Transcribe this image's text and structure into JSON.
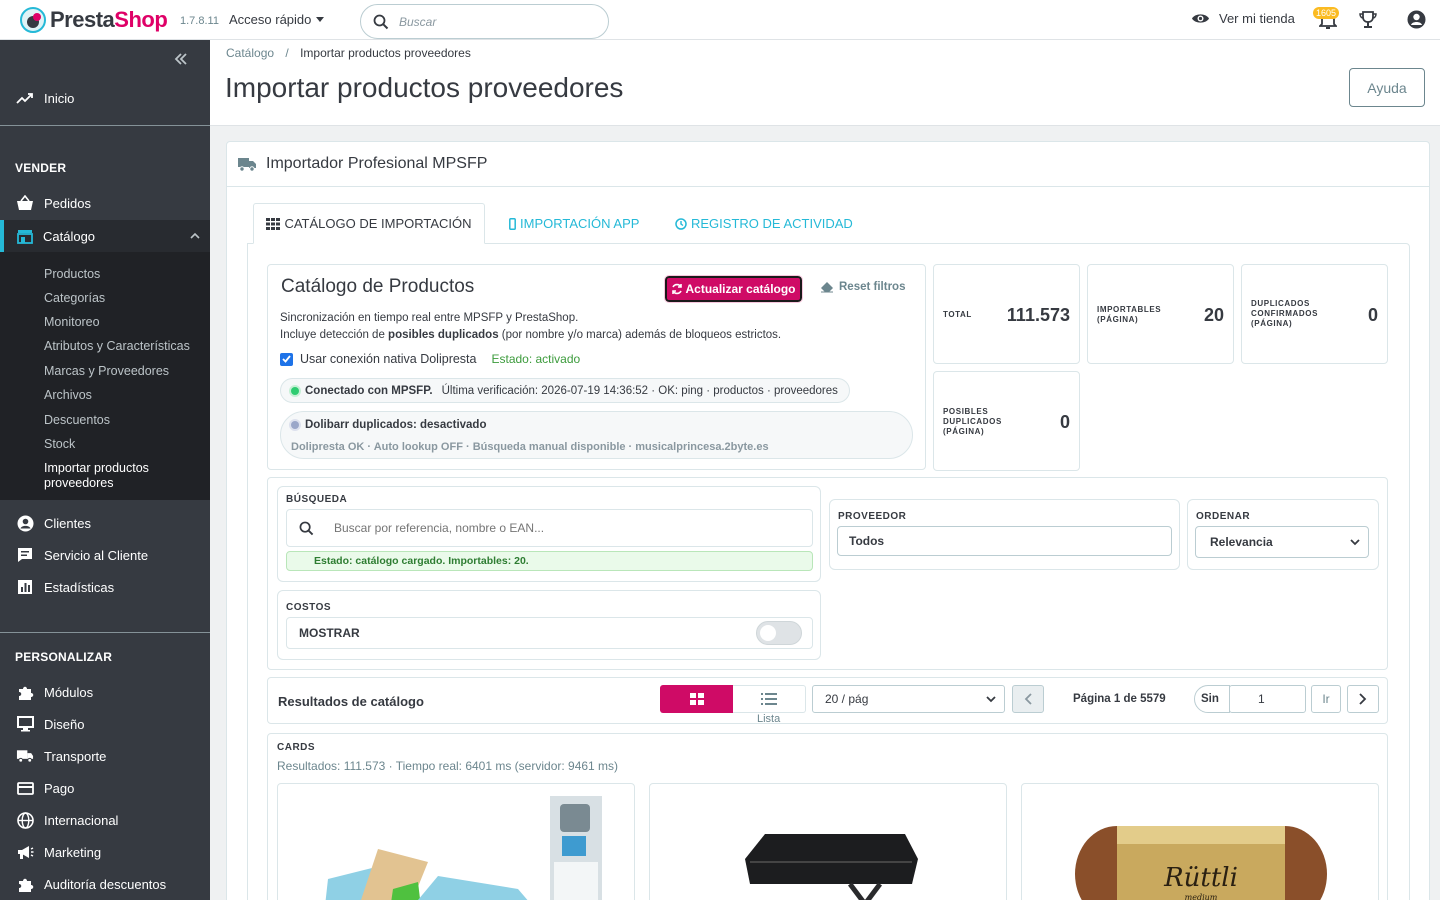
{
  "header": {
    "brand_a": "Presta",
    "brand_b": "Shop",
    "version": "1.7.8.11",
    "quick_access": "Acceso rápido",
    "search_placeholder": "Buscar",
    "view_shop": "Ver mi tienda",
    "notifications_count": "1605"
  },
  "sidebar": {
    "home": "Inicio",
    "sell_section": "VENDER",
    "orders": "Pedidos",
    "catalog": "Catálogo",
    "catalog_items": [
      "Productos",
      "Categorías",
      "Monitoreo",
      "Atributos y Características",
      "Marcas y Proveedores",
      "Archivos",
      "Descuentos",
      "Stock",
      "Importar productos proveedores"
    ],
    "customers": "Clientes",
    "service": "Servicio al Cliente",
    "stats": "Estadísticas",
    "custom_section": "PERSONALIZAR",
    "modules": "Módulos",
    "design": "Diseño",
    "shipping": "Transporte",
    "payment": "Pago",
    "international": "Internacional",
    "marketing": "Marketing",
    "audit": "Auditoría descuentos"
  },
  "page": {
    "breadcrumb_parent": "Catálogo",
    "breadcrumb_sep": "/",
    "breadcrumb_current": "Importar productos proveedores",
    "title": "Importar productos proveedores",
    "help": "Ayuda"
  },
  "panel": {
    "title": "Importador Profesional MPSFP",
    "tabs": [
      "CATÁLOGO DE IMPORTACIÓN",
      "IMPORTACIÓN APP",
      "REGISTRO DE ACTIVIDAD"
    ]
  },
  "catalog": {
    "title": "Catálogo de Productos",
    "update_button": "Actualizar catálogo",
    "reset_button": "Reset filtros",
    "desc_line1": "Sincronización en tiempo real entre MPSFP y PrestaShop.",
    "desc_line2_a": "Incluye detección de ",
    "desc_line2_b": "posibles duplicados",
    "desc_line2_c": " (por nombre y/o marca) además de bloqueos estrictos.",
    "native_label": "Usar conexión nativa Dolipresta",
    "native_status": "Estado: activado",
    "conn_label": "Conectado con MPSFP.",
    "conn_detail": "Última verificación: 2026-07-19 14:36:52 · OK: ping · productos · proveedores",
    "doli_label": "Dolibarr duplicados: desactivado",
    "doli_detail": "Dolipresta OK · Auto lookup OFF · Búsqueda manual disponible · musicalprincesa.2byte.es"
  },
  "stats": {
    "total_label": "TOTAL",
    "total_value": "111.573",
    "importables_label_1": "IMPORTABLES",
    "importables_label_2": "(PÁGINA)",
    "importables_value": "20",
    "dup_label_1": "DUPLICADOS",
    "dup_label_2": "CONFIRMADOS",
    "dup_label_3": "(PÁGINA)",
    "dup_value": "0",
    "pos_label_1": "POSIBLES",
    "pos_label_2": "DUPLICADOS",
    "pos_label_3": "(PÁGINA)",
    "pos_value": "0"
  },
  "filters": {
    "search_label": "BÚSQUEDA",
    "search_placeholder": "Buscar por referencia, nombre o EAN...",
    "search_status": "Estado: catálogo cargado. Importables: 20.",
    "provider_label": "PROVEEDOR",
    "provider_value": "Todos",
    "order_label": "ORDENAR",
    "order_value": "Relevancia",
    "costs_label": "COSTOS",
    "costs_value": "MOSTRAR"
  },
  "results": {
    "title": "Resultados de catálogo",
    "list_label": "Lista",
    "per_page": "20 / pág",
    "page_info": "Página 1 de 5579",
    "sin_label": "Sin",
    "page_input": "1",
    "go_label": "Ir"
  },
  "cards": {
    "label": "CARDS",
    "info": "Resultados: 111.573 · Tiempo real: 6401 ms (servidor: 9461 ms)",
    "product3_brand": "Rüttli",
    "product3_sub": "medium"
  },
  "colors": {
    "accent": "#25b9d7",
    "primary": "#cf0b66",
    "sidebar": "#363a41",
    "success": "#2ecc71"
  }
}
